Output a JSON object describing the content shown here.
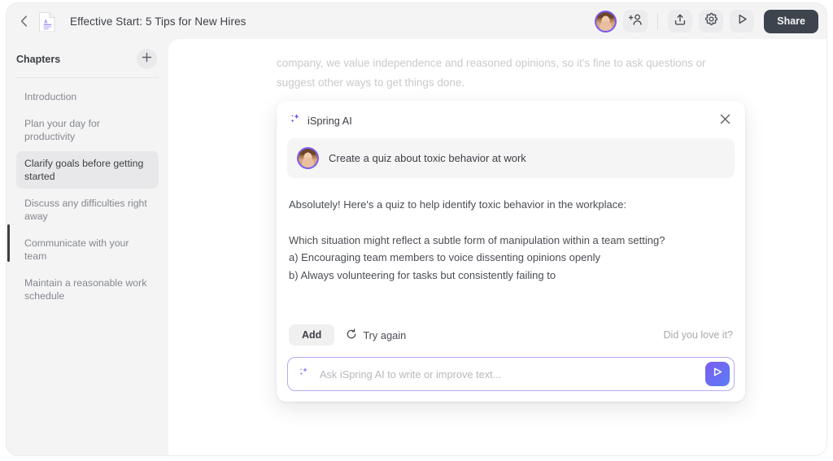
{
  "window": {
    "back_icon": "chevron-left-icon",
    "doc_icon": "document-icon",
    "title": "Effective Start: 5 Tips for New Hires"
  },
  "toolbar": {
    "avatar_name": "user-avatar",
    "add_user_icon": "add-user-icon",
    "upload_icon": "upload-icon",
    "settings_icon": "gear-icon",
    "preview_icon": "play-icon",
    "share_label": "Share",
    "share_bg": "#3e444e"
  },
  "sidebar": {
    "title": "Chapters",
    "add_icon": "plus-icon",
    "items": [
      {
        "label": "Introduction",
        "active": false
      },
      {
        "label": "Plan your day for productivity",
        "active": false
      },
      {
        "label": "Clarify goals before getting started",
        "active": true
      },
      {
        "label": "Discuss any difficulties right away",
        "active": false
      },
      {
        "label": "Communicate with your team",
        "active": false
      },
      {
        "label": "Maintain a reasonable work schedule",
        "active": false
      }
    ]
  },
  "document": {
    "body_text": "company, we value independence and reasoned opinions, so it's fine to ask questions or suggest other ways to get things done."
  },
  "ai_panel": {
    "brand": "iSpring AI",
    "sparkle_icon": "sparkles-icon",
    "close_icon": "close-icon",
    "prompt": "Create a quiz about toxic behavior at work",
    "answer_intro": "Absolutely! Here's a quiz to help identify toxic behavior in the workplace:",
    "answer_question": "Which situation might reflect a subtle form of manipulation within a team setting?",
    "answer_option_a": "a) Encouraging team members to voice dissenting opinions openly",
    "answer_option_b": "b) Always volunteering for tasks but consistently failing to",
    "add_label": "Add",
    "try_again_label": "Try again",
    "try_again_icon": "refresh-icon",
    "feedback_label": "Did you love it?",
    "input_placeholder": "Ask iSpring AI to write or improve text...",
    "input_value": "",
    "send_icon": "send-icon",
    "accent": "#7b5cf0"
  }
}
